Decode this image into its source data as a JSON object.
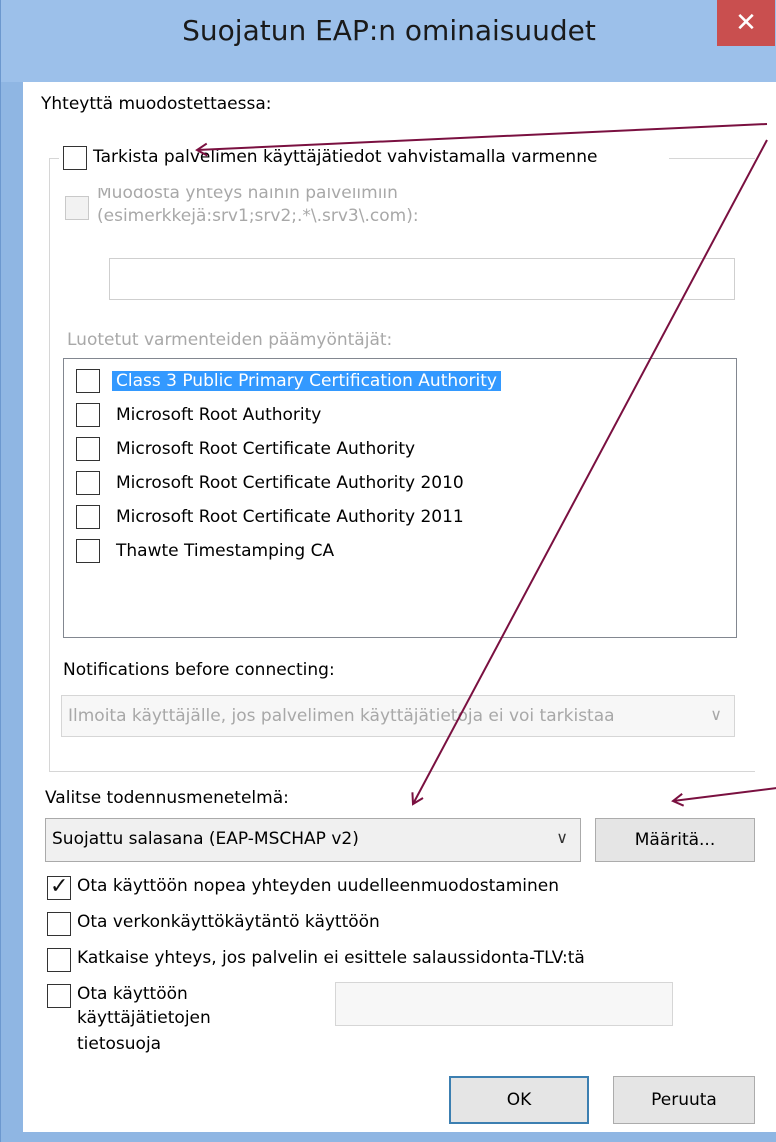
{
  "window": {
    "title": "Suojatun EAP:n ominaisuudet",
    "close_label": "✕"
  },
  "connecting": {
    "heading": "Yhteyttä muodostettaessa:",
    "verify_cert_label": "Tarkista palvelimen käyttäjätiedot vahvistamalla varmenne",
    "verify_cert_checked": false,
    "connect_servers_label_line1": "Muodosta yhteys näihin palvelimiin",
    "connect_servers_label_line2": "(esimerkkejä:srv1;srv2;.*\\.srv3\\.com):",
    "servers_value": "",
    "trusted_ca_heading": "Luotetut varmenteiden päämyöntäjät:",
    "trusted_cas": [
      {
        "label": "Class 3 Public Primary Certification Authority",
        "checked": false,
        "selected": true
      },
      {
        "label": "Microsoft Root Authority",
        "checked": false,
        "selected": false
      },
      {
        "label": "Microsoft Root Certificate Authority",
        "checked": false,
        "selected": false
      },
      {
        "label": "Microsoft Root Certificate Authority 2010",
        "checked": false,
        "selected": false
      },
      {
        "label": "Microsoft Root Certificate Authority 2011",
        "checked": false,
        "selected": false
      },
      {
        "label": "Thawte Timestamping CA",
        "checked": false,
        "selected": false
      }
    ],
    "notifications_heading": "Notifications before connecting:",
    "notifications_value": "Ilmoita käyttäjälle, jos palvelimen käyttäjätietoja ei voi tarkistaa"
  },
  "auth": {
    "heading": "Valitse todennusmenetelmä:",
    "method_value": "Suojattu salasana (EAP-MSCHAP v2)",
    "configure_label": "Määritä..."
  },
  "options": [
    {
      "label": "Ota käyttöön nopea yhteyden uudelleenmuodostaminen",
      "checked": true
    },
    {
      "label": "Ota verkonkäyttökäytäntö käyttöön",
      "checked": false
    },
    {
      "label": "Katkaise yhteys, jos palvelin ei esittele salaussidonta-TLV:tä",
      "checked": false
    }
  ],
  "privacy": {
    "label_line1": "Ota käyttöön",
    "label_line2": "käyttäjätietojen",
    "label_line3": "tietosuoja",
    "checked": false,
    "value": ""
  },
  "buttons": {
    "ok": "OK",
    "cancel": "Peruuta"
  },
  "colors": {
    "annotation_arrow": "#7a1040",
    "selection": "#3399ff",
    "close_button": "#c94f4f"
  }
}
